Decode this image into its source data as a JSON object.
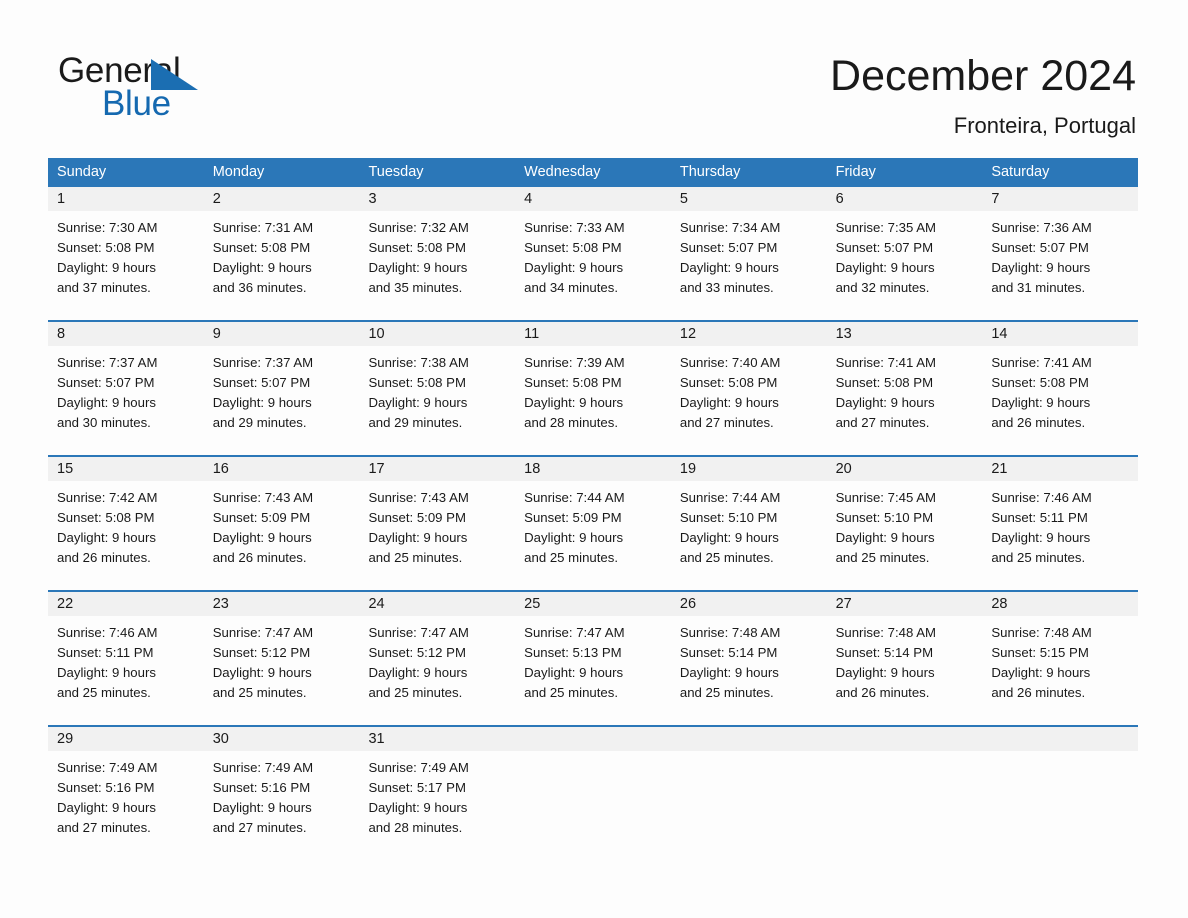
{
  "brand": {
    "name_part1": "General",
    "name_part2": "Blue",
    "accent_color": "#1b6eb2"
  },
  "header": {
    "title": "December 2024",
    "location": "Fronteira, Portugal"
  },
  "calendar": {
    "header_bg": "#2b77b8",
    "daynum_bg": "#f1f1f1",
    "day_names": [
      "Sunday",
      "Monday",
      "Tuesday",
      "Wednesday",
      "Thursday",
      "Friday",
      "Saturday"
    ],
    "weeks": [
      [
        {
          "day": "1",
          "sunrise": "Sunrise: 7:30 AM",
          "sunset": "Sunset: 5:08 PM",
          "daylight_line1": "Daylight: 9 hours",
          "daylight_line2": "and 37 minutes."
        },
        {
          "day": "2",
          "sunrise": "Sunrise: 7:31 AM",
          "sunset": "Sunset: 5:08 PM",
          "daylight_line1": "Daylight: 9 hours",
          "daylight_line2": "and 36 minutes."
        },
        {
          "day": "3",
          "sunrise": "Sunrise: 7:32 AM",
          "sunset": "Sunset: 5:08 PM",
          "daylight_line1": "Daylight: 9 hours",
          "daylight_line2": "and 35 minutes."
        },
        {
          "day": "4",
          "sunrise": "Sunrise: 7:33 AM",
          "sunset": "Sunset: 5:08 PM",
          "daylight_line1": "Daylight: 9 hours",
          "daylight_line2": "and 34 minutes."
        },
        {
          "day": "5",
          "sunrise": "Sunrise: 7:34 AM",
          "sunset": "Sunset: 5:07 PM",
          "daylight_line1": "Daylight: 9 hours",
          "daylight_line2": "and 33 minutes."
        },
        {
          "day": "6",
          "sunrise": "Sunrise: 7:35 AM",
          "sunset": "Sunset: 5:07 PM",
          "daylight_line1": "Daylight: 9 hours",
          "daylight_line2": "and 32 minutes."
        },
        {
          "day": "7",
          "sunrise": "Sunrise: 7:36 AM",
          "sunset": "Sunset: 5:07 PM",
          "daylight_line1": "Daylight: 9 hours",
          "daylight_line2": "and 31 minutes."
        }
      ],
      [
        {
          "day": "8",
          "sunrise": "Sunrise: 7:37 AM",
          "sunset": "Sunset: 5:07 PM",
          "daylight_line1": "Daylight: 9 hours",
          "daylight_line2": "and 30 minutes."
        },
        {
          "day": "9",
          "sunrise": "Sunrise: 7:37 AM",
          "sunset": "Sunset: 5:07 PM",
          "daylight_line1": "Daylight: 9 hours",
          "daylight_line2": "and 29 minutes."
        },
        {
          "day": "10",
          "sunrise": "Sunrise: 7:38 AM",
          "sunset": "Sunset: 5:08 PM",
          "daylight_line1": "Daylight: 9 hours",
          "daylight_line2": "and 29 minutes."
        },
        {
          "day": "11",
          "sunrise": "Sunrise: 7:39 AM",
          "sunset": "Sunset: 5:08 PM",
          "daylight_line1": "Daylight: 9 hours",
          "daylight_line2": "and 28 minutes."
        },
        {
          "day": "12",
          "sunrise": "Sunrise: 7:40 AM",
          "sunset": "Sunset: 5:08 PM",
          "daylight_line1": "Daylight: 9 hours",
          "daylight_line2": "and 27 minutes."
        },
        {
          "day": "13",
          "sunrise": "Sunrise: 7:41 AM",
          "sunset": "Sunset: 5:08 PM",
          "daylight_line1": "Daylight: 9 hours",
          "daylight_line2": "and 27 minutes."
        },
        {
          "day": "14",
          "sunrise": "Sunrise: 7:41 AM",
          "sunset": "Sunset: 5:08 PM",
          "daylight_line1": "Daylight: 9 hours",
          "daylight_line2": "and 26 minutes."
        }
      ],
      [
        {
          "day": "15",
          "sunrise": "Sunrise: 7:42 AM",
          "sunset": "Sunset: 5:08 PM",
          "daylight_line1": "Daylight: 9 hours",
          "daylight_line2": "and 26 minutes."
        },
        {
          "day": "16",
          "sunrise": "Sunrise: 7:43 AM",
          "sunset": "Sunset: 5:09 PM",
          "daylight_line1": "Daylight: 9 hours",
          "daylight_line2": "and 26 minutes."
        },
        {
          "day": "17",
          "sunrise": "Sunrise: 7:43 AM",
          "sunset": "Sunset: 5:09 PM",
          "daylight_line1": "Daylight: 9 hours",
          "daylight_line2": "and 25 minutes."
        },
        {
          "day": "18",
          "sunrise": "Sunrise: 7:44 AM",
          "sunset": "Sunset: 5:09 PM",
          "daylight_line1": "Daylight: 9 hours",
          "daylight_line2": "and 25 minutes."
        },
        {
          "day": "19",
          "sunrise": "Sunrise: 7:44 AM",
          "sunset": "Sunset: 5:10 PM",
          "daylight_line1": "Daylight: 9 hours",
          "daylight_line2": "and 25 minutes."
        },
        {
          "day": "20",
          "sunrise": "Sunrise: 7:45 AM",
          "sunset": "Sunset: 5:10 PM",
          "daylight_line1": "Daylight: 9 hours",
          "daylight_line2": "and 25 minutes."
        },
        {
          "day": "21",
          "sunrise": "Sunrise: 7:46 AM",
          "sunset": "Sunset: 5:11 PM",
          "daylight_line1": "Daylight: 9 hours",
          "daylight_line2": "and 25 minutes."
        }
      ],
      [
        {
          "day": "22",
          "sunrise": "Sunrise: 7:46 AM",
          "sunset": "Sunset: 5:11 PM",
          "daylight_line1": "Daylight: 9 hours",
          "daylight_line2": "and 25 minutes."
        },
        {
          "day": "23",
          "sunrise": "Sunrise: 7:47 AM",
          "sunset": "Sunset: 5:12 PM",
          "daylight_line1": "Daylight: 9 hours",
          "daylight_line2": "and 25 minutes."
        },
        {
          "day": "24",
          "sunrise": "Sunrise: 7:47 AM",
          "sunset": "Sunset: 5:12 PM",
          "daylight_line1": "Daylight: 9 hours",
          "daylight_line2": "and 25 minutes."
        },
        {
          "day": "25",
          "sunrise": "Sunrise: 7:47 AM",
          "sunset": "Sunset: 5:13 PM",
          "daylight_line1": "Daylight: 9 hours",
          "daylight_line2": "and 25 minutes."
        },
        {
          "day": "26",
          "sunrise": "Sunrise: 7:48 AM",
          "sunset": "Sunset: 5:14 PM",
          "daylight_line1": "Daylight: 9 hours",
          "daylight_line2": "and 25 minutes."
        },
        {
          "day": "27",
          "sunrise": "Sunrise: 7:48 AM",
          "sunset": "Sunset: 5:14 PM",
          "daylight_line1": "Daylight: 9 hours",
          "daylight_line2": "and 26 minutes."
        },
        {
          "day": "28",
          "sunrise": "Sunrise: 7:48 AM",
          "sunset": "Sunset: 5:15 PM",
          "daylight_line1": "Daylight: 9 hours",
          "daylight_line2": "and 26 minutes."
        }
      ],
      [
        {
          "day": "29",
          "sunrise": "Sunrise: 7:49 AM",
          "sunset": "Sunset: 5:16 PM",
          "daylight_line1": "Daylight: 9 hours",
          "daylight_line2": "and 27 minutes."
        },
        {
          "day": "30",
          "sunrise": "Sunrise: 7:49 AM",
          "sunset": "Sunset: 5:16 PM",
          "daylight_line1": "Daylight: 9 hours",
          "daylight_line2": "and 27 minutes."
        },
        {
          "day": "31",
          "sunrise": "Sunrise: 7:49 AM",
          "sunset": "Sunset: 5:17 PM",
          "daylight_line1": "Daylight: 9 hours",
          "daylight_line2": "and 28 minutes."
        },
        {
          "day": "",
          "sunrise": "",
          "sunset": "",
          "daylight_line1": "",
          "daylight_line2": ""
        },
        {
          "day": "",
          "sunrise": "",
          "sunset": "",
          "daylight_line1": "",
          "daylight_line2": ""
        },
        {
          "day": "",
          "sunrise": "",
          "sunset": "",
          "daylight_line1": "",
          "daylight_line2": ""
        },
        {
          "day": "",
          "sunrise": "",
          "sunset": "",
          "daylight_line1": "",
          "daylight_line2": ""
        }
      ]
    ]
  }
}
